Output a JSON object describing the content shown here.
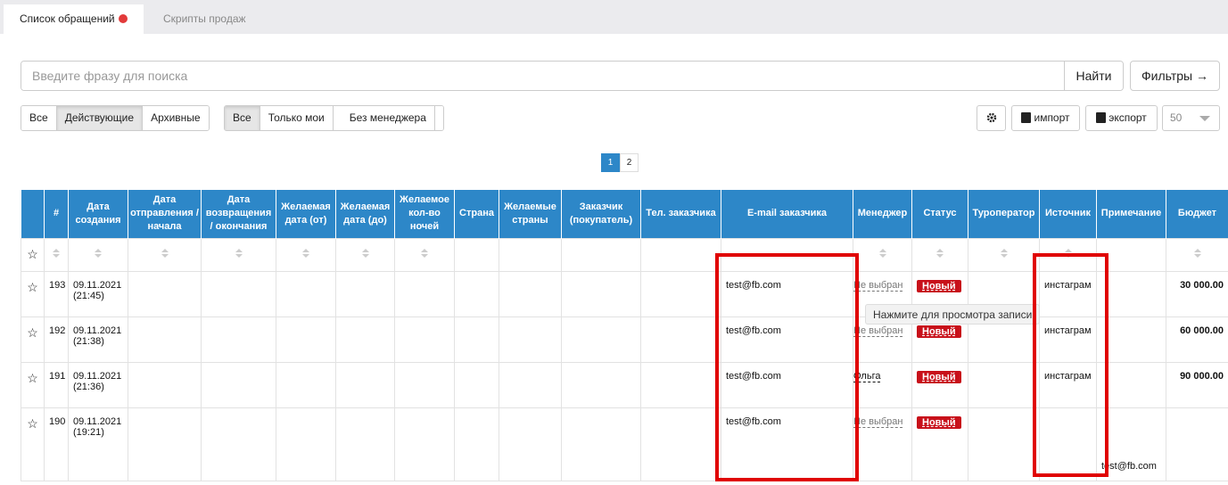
{
  "tabs": [
    {
      "label": "Список обращений",
      "active": true,
      "has_dot": true
    },
    {
      "label": "Скрипты продаж",
      "active": false
    }
  ],
  "search": {
    "placeholder": "Введите фразу для поиска",
    "button": "Найти"
  },
  "filters_button": "Фильтры →",
  "status_filter": [
    "Все",
    "Действующие",
    "Архивные"
  ],
  "status_filter_selected": "Действующие",
  "owner_filter": [
    "Все",
    "Только мои",
    "Без менеджера"
  ],
  "owner_filter_selected": "Все",
  "tools": {
    "import": "импорт",
    "export": "экспорт",
    "per_page": "50"
  },
  "pagination": {
    "pages": [
      "1",
      "2"
    ],
    "current": "1"
  },
  "table": {
    "headers": [
      "#",
      "Дата создания",
      "Дата отправления / начала",
      "Дата возвращения / окончания",
      "Желаемая дата (от)",
      "Желаемая дата (до)",
      "Желаемое кол-во ночей",
      "Страна",
      "Желаемые страны",
      "Заказчик (покупатель)",
      "Тел. заказчика",
      "E-mail заказчика",
      "Менеджер",
      "Статус",
      "Туроператор",
      "Источник",
      "Примечание",
      "Бюджет"
    ],
    "rows": [
      {
        "id": "193",
        "created": "09.11.2021",
        "created_time": "(21:45)",
        "email": "test@fb.com",
        "manager": "Не выбран",
        "status": "Новый",
        "source": "инстаграм",
        "note": "",
        "budget": "30 000.00"
      },
      {
        "id": "192",
        "created": "09.11.2021",
        "created_time": "(21:38)",
        "email": "test@fb.com",
        "manager": "Не выбран",
        "status": "Новый",
        "source": "инстаграм",
        "note": "",
        "budget": "60 000.00"
      },
      {
        "id": "191",
        "created": "09.11.2021",
        "created_time": "(21:36)",
        "email": "test@fb.com",
        "manager": "Ольга",
        "status": "Новый",
        "source": "инстаграм",
        "note": "",
        "budget": "90 000.00"
      },
      {
        "id": "190",
        "created": "09.11.2021",
        "created_time": "(19:21)",
        "email": "test@fb.com",
        "manager": "Не выбран",
        "status": "Новый",
        "source": "",
        "note": "test@fb.com",
        "budget": ""
      }
    ]
  },
  "tooltip": "Нажмите для просмотра записи",
  "colors": {
    "header_bg": "#2d87c8",
    "status_badge": "#c8101a",
    "highlight": "#e00000",
    "dot": "#e23a3a"
  }
}
